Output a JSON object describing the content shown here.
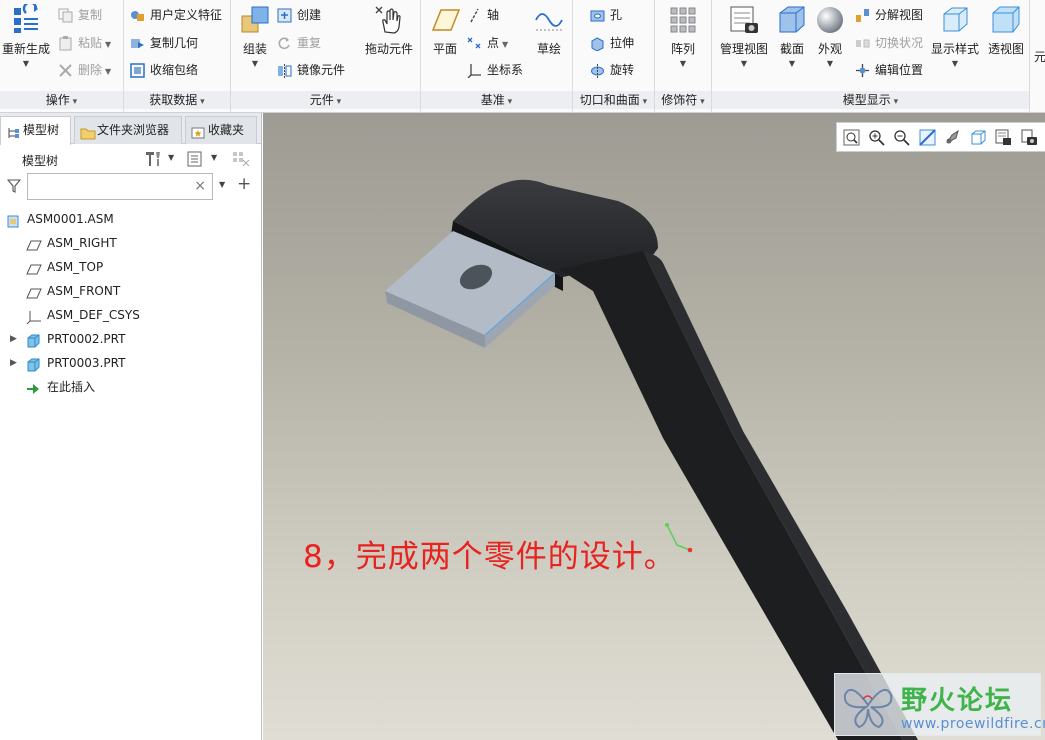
{
  "ribbon": {
    "operations": {
      "label": "操作",
      "regenerate": "重新生成",
      "copy": "复制",
      "paste": "粘贴",
      "delete": "删除"
    },
    "get_data": {
      "label": "获取数据",
      "user_defined_feature": "用户定义特征",
      "copy_geometry": "复制几何",
      "shrinkwrap": "收缩包络"
    },
    "component": {
      "label": "元件",
      "assemble": "组装",
      "create": "创建",
      "repeat": "重复",
      "mirror_component": "镜像元件",
      "drag_components": "拖动元件"
    },
    "datum": {
      "label": "基准",
      "plane": "平面",
      "axis": "轴",
      "point": "点",
      "csys": "坐标系",
      "sketch": "草绘"
    },
    "cut_surface": {
      "label": "切口和曲面",
      "hole": "孔",
      "extrude": "拉伸",
      "revolve": "旋转"
    },
    "modifiers": {
      "label": "修饰符",
      "pattern": "阵列"
    },
    "model_display": {
      "label": "模型显示",
      "manage_views": "管理视图",
      "section": "截面",
      "appearance": "外观",
      "explode_view": "分解视图",
      "toggle_status": "切换状况",
      "edit_position": "编辑位置",
      "display_style": "显示样式",
      "perspective": "透视图",
      "overflow": "元"
    }
  },
  "panel": {
    "tabs": [
      "模型树",
      "文件夹浏览器",
      "收藏夹"
    ],
    "tree_title": "模型树",
    "search_placeholder": "",
    "tree_items": [
      {
        "label": "ASM0001.ASM"
      },
      {
        "label": "ASM_RIGHT"
      },
      {
        "label": "ASM_TOP"
      },
      {
        "label": "ASM_FRONT"
      },
      {
        "label": "ASM_DEF_CSYS"
      },
      {
        "label": "PRT0002.PRT"
      },
      {
        "label": "PRT0003.PRT"
      },
      {
        "label": "在此插入"
      }
    ]
  },
  "viewport": {
    "annotation": "8，完成两个零件的设计。",
    "watermark_title": "野火论坛",
    "watermark_url": "www.proewildfire.cn"
  },
  "colors": {
    "annotation": "#e8231f",
    "part_dark": "#1d1e20",
    "part_light": "#aeb7c0",
    "watermark_green": "#3fb44a"
  }
}
